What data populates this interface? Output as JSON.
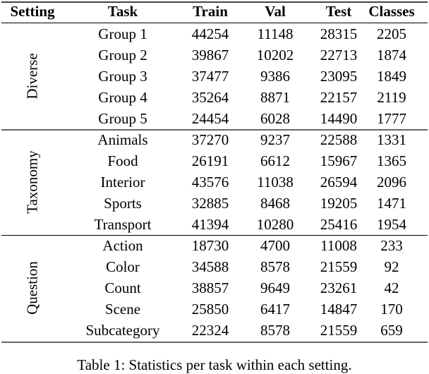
{
  "table": {
    "headers": [
      "Setting",
      "Task",
      "Train",
      "Val",
      "Test",
      "Classes"
    ],
    "groups": [
      {
        "setting": "Diverse",
        "rows": [
          {
            "task": "Group 1",
            "train": "44254",
            "val": "11148",
            "test": "28315",
            "classes": "2205"
          },
          {
            "task": "Group 2",
            "train": "39867",
            "val": "10202",
            "test": "22713",
            "classes": "1874"
          },
          {
            "task": "Group 3",
            "train": "37477",
            "val": "9386",
            "test": "23095",
            "classes": "1849"
          },
          {
            "task": "Group 4",
            "train": "35264",
            "val": "8871",
            "test": "22157",
            "classes": "2119"
          },
          {
            "task": "Group 5",
            "train": "24454",
            "val": "6028",
            "test": "14490",
            "classes": "1777"
          }
        ]
      },
      {
        "setting": "Taxonomy",
        "rows": [
          {
            "task": "Animals",
            "train": "37270",
            "val": "9237",
            "test": "22588",
            "classes": "1331"
          },
          {
            "task": "Food",
            "train": "26191",
            "val": "6612",
            "test": "15967",
            "classes": "1365"
          },
          {
            "task": "Interior",
            "train": "43576",
            "val": "11038",
            "test": "26594",
            "classes": "2096"
          },
          {
            "task": "Sports",
            "train": "32885",
            "val": "8468",
            "test": "19205",
            "classes": "1471"
          },
          {
            "task": "Transport",
            "train": "41394",
            "val": "10280",
            "test": "25416",
            "classes": "1954"
          }
        ]
      },
      {
        "setting": "Question",
        "rows": [
          {
            "task": "Action",
            "train": "18730",
            "val": "4700",
            "test": "11008",
            "classes": "233"
          },
          {
            "task": "Color",
            "train": "34588",
            "val": "8578",
            "test": "21559",
            "classes": "92"
          },
          {
            "task": "Count",
            "train": "38857",
            "val": "9649",
            "test": "23261",
            "classes": "42"
          },
          {
            "task": "Scene",
            "train": "25850",
            "val": "6417",
            "test": "14847",
            "classes": "170"
          },
          {
            "task": "Subcategory",
            "train": "22324",
            "val": "8578",
            "test": "21559",
            "classes": "659"
          }
        ]
      }
    ]
  },
  "caption": "Table 1: Statistics per task within each setting."
}
